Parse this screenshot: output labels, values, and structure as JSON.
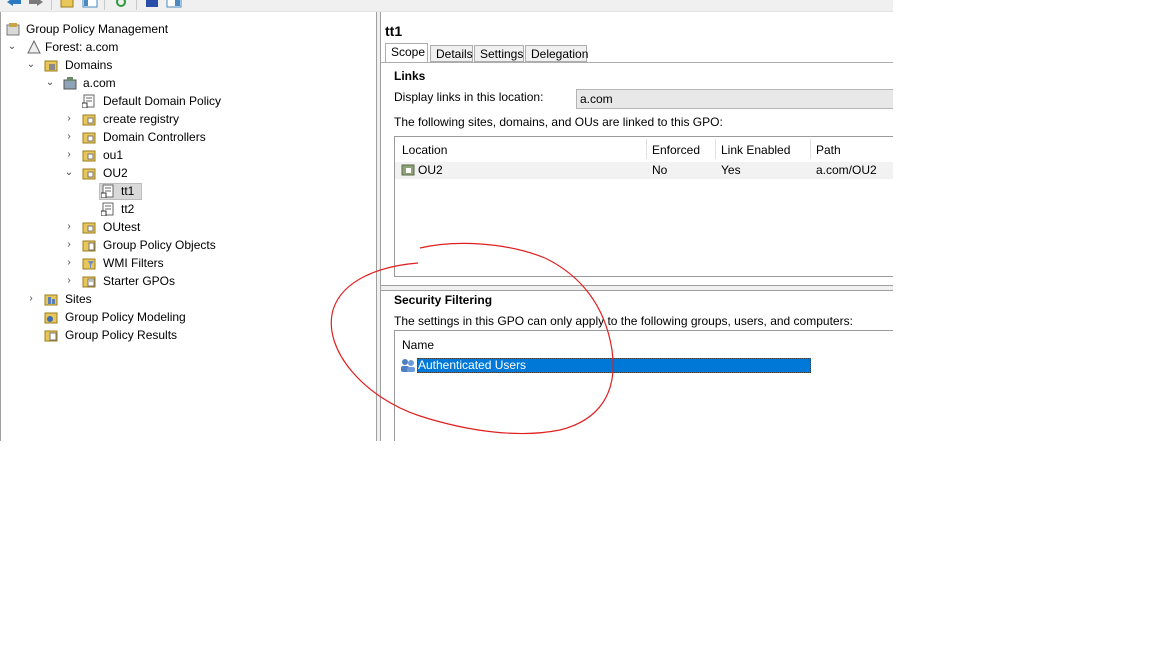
{
  "app": {
    "root_label": "Group Policy Management"
  },
  "tree": {
    "forest": "Forest: a.com",
    "domains": "Domains",
    "domain": "a.com",
    "items": {
      "default_domain_policy": "Default Domain Policy",
      "create_registry": "create registry",
      "domain_controllers": "Domain Controllers",
      "ou1": "ou1",
      "ou2": "OU2",
      "tt1": "tt1",
      "tt2": "tt2",
      "outest": "OUtest",
      "gpo": "Group Policy Objects",
      "wmi": "WMI Filters",
      "starter": "Starter GPOs"
    },
    "sites": "Sites",
    "modeling": "Group Policy Modeling",
    "results": "Group Policy Results",
    "selected": "tt1"
  },
  "details": {
    "title": "tt1",
    "tabs": [
      "Scope",
      "Details",
      "Settings",
      "Delegation"
    ],
    "active_tab": "Scope",
    "links": {
      "heading": "Links",
      "display_label": "Display links in this location:",
      "display_value": "a.com",
      "description": "The following sites, domains, and OUs are linked to this GPO:",
      "columns": [
        "Location",
        "Enforced",
        "Link Enabled",
        "Path"
      ],
      "rows": [
        {
          "location": "OU2",
          "enforced": "No",
          "link_enabled": "Yes",
          "path": "a.com/OU2"
        }
      ]
    },
    "security_filtering": {
      "heading": "Security Filtering",
      "description": "The settings in this GPO can only apply to the following groups, users, and computers:",
      "columns": [
        "Name"
      ],
      "rows": [
        {
          "name": "Authenticated Users",
          "selected": true
        }
      ]
    }
  },
  "annotation": {
    "color": "#e02020"
  },
  "colors": {
    "selection": "#0078d7",
    "folder": "#e8c65a"
  }
}
